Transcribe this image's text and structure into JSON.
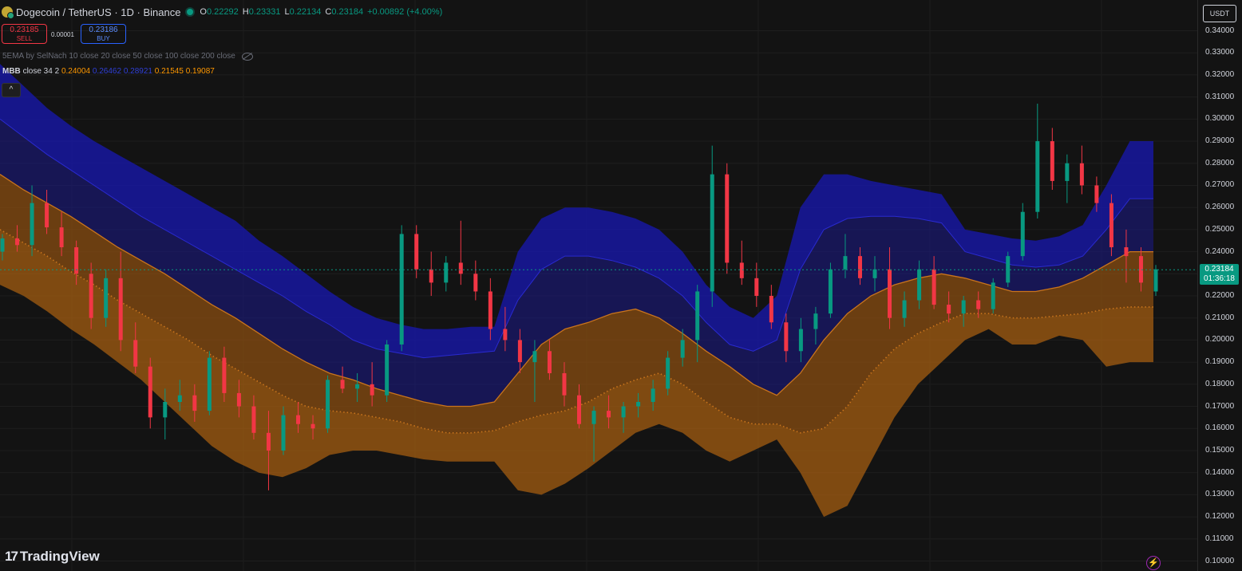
{
  "header": {
    "symbol_title": "Dogecoin / TetherUS · 1D · Binance",
    "ohlc": [
      {
        "label": "O",
        "value": "0.22292"
      },
      {
        "label": "H",
        "value": "0.23331"
      },
      {
        "label": "L",
        "value": "0.22134"
      },
      {
        "label": "C",
        "value": "0.23184"
      }
    ],
    "change": "+0.00892 (+4.00%)"
  },
  "trade": {
    "sell_price": "0.23185",
    "sell_label": "SELL",
    "spread": "0.00001",
    "buy_price": "0.23186",
    "buy_label": "BUY"
  },
  "indicators": {
    "ema_line": "5EMA by SelNach 10 close 20 close 50 close 100 close 200 close",
    "mbb_name": "MBB",
    "mbb_params": "close 34 2",
    "mbb_values": [
      "0.24004",
      "0.26462",
      "0.28921",
      "0.21545",
      "0.19087"
    ],
    "collapse_glyph": "^"
  },
  "axis": {
    "currency": "USDT",
    "ticks": [
      "0.34000",
      "0.33000",
      "0.32000",
      "0.31000",
      "0.30000",
      "0.29000",
      "0.28000",
      "0.27000",
      "0.26000",
      "0.25000",
      "0.24000",
      "0.23000",
      "0.22000",
      "0.21000",
      "0.20000",
      "0.19000",
      "0.18000",
      "0.17000",
      "0.16000",
      "0.15000",
      "0.14000",
      "0.13000",
      "0.12000",
      "0.11000",
      "0.10000"
    ],
    "current_price": "0.23184",
    "countdown": "01:36:18"
  },
  "brand": {
    "name": "TradingView",
    "mark": "17"
  },
  "colors": {
    "up": "#089981",
    "down": "#f23645",
    "upper_band": "#1c1aa8",
    "mid_band": "#2a2f9f",
    "lower_band": "#9a5a10",
    "basis": "#ff9800",
    "background": "#131313"
  },
  "chart_data": {
    "type": "candlestick",
    "ylim": [
      0.1,
      0.345
    ],
    "bands": {
      "upper_outer": [
        0.325,
        0.315,
        0.305,
        0.297,
        0.29,
        0.284,
        0.278,
        0.272,
        0.266,
        0.26,
        0.254,
        0.245,
        0.238,
        0.23,
        0.222,
        0.215,
        0.21,
        0.207,
        0.205,
        0.205,
        0.206,
        0.206,
        0.24,
        0.255,
        0.26,
        0.26,
        0.258,
        0.255,
        0.25,
        0.24,
        0.225,
        0.215,
        0.21,
        0.22,
        0.26,
        0.275,
        0.275,
        0.272,
        0.27,
        0.268,
        0.266,
        0.25,
        0.248,
        0.246,
        0.245,
        0.247,
        0.252,
        0.27,
        0.29,
        0.29
      ],
      "upper_inner": [
        0.3,
        0.292,
        0.284,
        0.277,
        0.27,
        0.263,
        0.256,
        0.25,
        0.244,
        0.238,
        0.232,
        0.226,
        0.22,
        0.213,
        0.207,
        0.2,
        0.196,
        0.194,
        0.192,
        0.193,
        0.194,
        0.195,
        0.218,
        0.232,
        0.238,
        0.238,
        0.236,
        0.233,
        0.228,
        0.22,
        0.208,
        0.198,
        0.195,
        0.2,
        0.232,
        0.25,
        0.255,
        0.256,
        0.256,
        0.255,
        0.253,
        0.24,
        0.237,
        0.234,
        0.233,
        0.234,
        0.238,
        0.25,
        0.264,
        0.264
      ],
      "basis": [
        0.275,
        0.268,
        0.262,
        0.256,
        0.249,
        0.242,
        0.236,
        0.23,
        0.223,
        0.216,
        0.21,
        0.203,
        0.196,
        0.19,
        0.185,
        0.182,
        0.178,
        0.175,
        0.172,
        0.17,
        0.17,
        0.172,
        0.185,
        0.198,
        0.205,
        0.208,
        0.212,
        0.214,
        0.21,
        0.203,
        0.195,
        0.188,
        0.18,
        0.175,
        0.185,
        0.2,
        0.212,
        0.22,
        0.225,
        0.228,
        0.23,
        0.228,
        0.225,
        0.222,
        0.222,
        0.224,
        0.228,
        0.234,
        0.24,
        0.24
      ],
      "lower_inner": [
        0.25,
        0.244,
        0.238,
        0.231,
        0.225,
        0.218,
        0.212,
        0.206,
        0.2,
        0.193,
        0.187,
        0.181,
        0.175,
        0.17,
        0.168,
        0.167,
        0.165,
        0.163,
        0.16,
        0.158,
        0.158,
        0.159,
        0.163,
        0.166,
        0.168,
        0.172,
        0.178,
        0.182,
        0.185,
        0.18,
        0.172,
        0.165,
        0.162,
        0.162,
        0.158,
        0.16,
        0.17,
        0.185,
        0.196,
        0.203,
        0.208,
        0.212,
        0.212,
        0.21,
        0.21,
        0.211,
        0.212,
        0.214,
        0.215,
        0.215
      ],
      "lower_outer": [
        0.225,
        0.22,
        0.213,
        0.205,
        0.198,
        0.19,
        0.182,
        0.172,
        0.162,
        0.152,
        0.145,
        0.14,
        0.138,
        0.142,
        0.148,
        0.15,
        0.15,
        0.148,
        0.146,
        0.145,
        0.145,
        0.145,
        0.132,
        0.13,
        0.135,
        0.142,
        0.15,
        0.158,
        0.162,
        0.158,
        0.15,
        0.145,
        0.15,
        0.155,
        0.14,
        0.12,
        0.125,
        0.145,
        0.165,
        0.18,
        0.19,
        0.2,
        0.205,
        0.198,
        0.198,
        0.202,
        0.2,
        0.188,
        0.19,
        0.19
      ]
    },
    "candles": [
      [
        0.24,
        0.248,
        0.236,
        0.246
      ],
      [
        0.246,
        0.252,
        0.24,
        0.243
      ],
      [
        0.243,
        0.27,
        0.238,
        0.262
      ],
      [
        0.262,
        0.268,
        0.248,
        0.251
      ],
      [
        0.251,
        0.258,
        0.238,
        0.242
      ],
      [
        0.242,
        0.245,
        0.225,
        0.23
      ],
      [
        0.23,
        0.235,
        0.205,
        0.21
      ],
      [
        0.21,
        0.232,
        0.206,
        0.228
      ],
      [
        0.228,
        0.24,
        0.195,
        0.2
      ],
      [
        0.2,
        0.208,
        0.185,
        0.188
      ],
      [
        0.188,
        0.192,
        0.16,
        0.165
      ],
      [
        0.165,
        0.178,
        0.155,
        0.172
      ],
      [
        0.172,
        0.182,
        0.168,
        0.175
      ],
      [
        0.175,
        0.18,
        0.163,
        0.168
      ],
      [
        0.168,
        0.195,
        0.166,
        0.192
      ],
      [
        0.192,
        0.197,
        0.172,
        0.176
      ],
      [
        0.176,
        0.182,
        0.165,
        0.17
      ],
      [
        0.17,
        0.175,
        0.155,
        0.158
      ],
      [
        0.158,
        0.168,
        0.132,
        0.15
      ],
      [
        0.15,
        0.17,
        0.148,
        0.166
      ],
      [
        0.166,
        0.172,
        0.158,
        0.162
      ],
      [
        0.162,
        0.166,
        0.155,
        0.16
      ],
      [
        0.16,
        0.184,
        0.158,
        0.182
      ],
      [
        0.182,
        0.188,
        0.176,
        0.178
      ],
      [
        0.178,
        0.185,
        0.172,
        0.18
      ],
      [
        0.18,
        0.19,
        0.17,
        0.175
      ],
      [
        0.175,
        0.2,
        0.172,
        0.198
      ],
      [
        0.198,
        0.252,
        0.195,
        0.248
      ],
      [
        0.248,
        0.252,
        0.228,
        0.232
      ],
      [
        0.232,
        0.24,
        0.22,
        0.226
      ],
      [
        0.226,
        0.238,
        0.222,
        0.235
      ],
      [
        0.235,
        0.254,
        0.225,
        0.23
      ],
      [
        0.23,
        0.236,
        0.218,
        0.222
      ],
      [
        0.222,
        0.228,
        0.2,
        0.205
      ],
      [
        0.205,
        0.215,
        0.195,
        0.2
      ],
      [
        0.2,
        0.205,
        0.185,
        0.19
      ],
      [
        0.19,
        0.2,
        0.172,
        0.195
      ],
      [
        0.195,
        0.2,
        0.182,
        0.185
      ],
      [
        0.185,
        0.19,
        0.17,
        0.175
      ],
      [
        0.175,
        0.18,
        0.16,
        0.162
      ],
      [
        0.162,
        0.17,
        0.145,
        0.168
      ],
      [
        0.168,
        0.175,
        0.16,
        0.165
      ],
      [
        0.165,
        0.172,
        0.158,
        0.17
      ],
      [
        0.17,
        0.176,
        0.165,
        0.172
      ],
      [
        0.172,
        0.182,
        0.168,
        0.178
      ],
      [
        0.178,
        0.195,
        0.175,
        0.192
      ],
      [
        0.192,
        0.205,
        0.188,
        0.2
      ],
      [
        0.2,
        0.225,
        0.19,
        0.222
      ],
      [
        0.222,
        0.288,
        0.215,
        0.275
      ],
      [
        0.275,
        0.28,
        0.23,
        0.235
      ],
      [
        0.235,
        0.245,
        0.225,
        0.228
      ],
      [
        0.228,
        0.235,
        0.215,
        0.22
      ],
      [
        0.22,
        0.225,
        0.205,
        0.208
      ],
      [
        0.208,
        0.212,
        0.19,
        0.195
      ],
      [
        0.195,
        0.21,
        0.19,
        0.205
      ],
      [
        0.205,
        0.215,
        0.198,
        0.212
      ],
      [
        0.212,
        0.235,
        0.21,
        0.232
      ],
      [
        0.232,
        0.248,
        0.228,
        0.238
      ],
      [
        0.238,
        0.242,
        0.225,
        0.228
      ],
      [
        0.228,
        0.238,
        0.222,
        0.232
      ],
      [
        0.232,
        0.242,
        0.205,
        0.21
      ],
      [
        0.21,
        0.222,
        0.206,
        0.218
      ],
      [
        0.218,
        0.236,
        0.214,
        0.232
      ],
      [
        0.232,
        0.238,
        0.214,
        0.216
      ],
      [
        0.216,
        0.222,
        0.208,
        0.212
      ],
      [
        0.212,
        0.22,
        0.206,
        0.218
      ],
      [
        0.218,
        0.222,
        0.21,
        0.214
      ],
      [
        0.214,
        0.228,
        0.212,
        0.226
      ],
      [
        0.226,
        0.24,
        0.224,
        0.238
      ],
      [
        0.238,
        0.262,
        0.236,
        0.258
      ],
      [
        0.258,
        0.307,
        0.255,
        0.29
      ],
      [
        0.29,
        0.296,
        0.268,
        0.272
      ],
      [
        0.272,
        0.284,
        0.262,
        0.28
      ],
      [
        0.28,
        0.288,
        0.266,
        0.27
      ],
      [
        0.27,
        0.274,
        0.258,
        0.262
      ],
      [
        0.262,
        0.266,
        0.238,
        0.242
      ],
      [
        0.242,
        0.25,
        0.226,
        0.238
      ],
      [
        0.238,
        0.242,
        0.222,
        0.226
      ],
      [
        0.222,
        0.234,
        0.22,
        0.232
      ]
    ]
  }
}
